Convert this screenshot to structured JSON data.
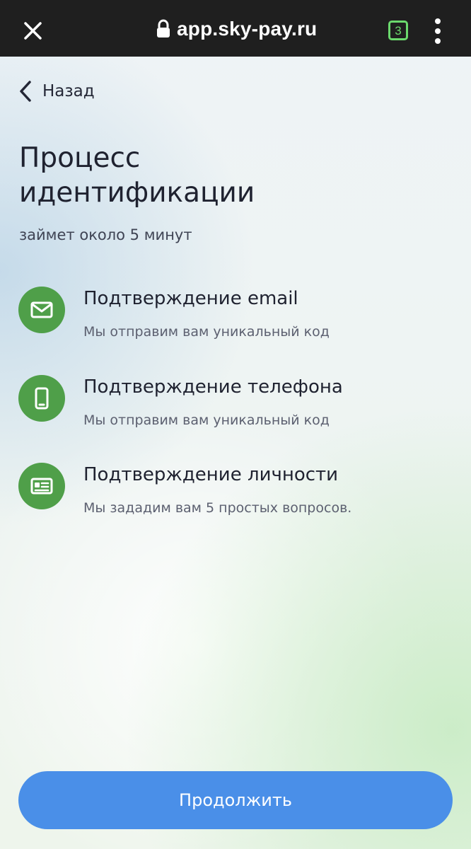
{
  "browser": {
    "close_icon": "close-icon",
    "lock_icon": "lock-icon",
    "url": "app.sky-pay.ru",
    "tab_count": "3",
    "tab_count_color": "#6bd96d",
    "menu_icon": "more-vert-icon",
    "topbar_color": "#1f1f1f"
  },
  "page": {
    "back": {
      "icon": "chevron-left-icon",
      "label": "Назад"
    },
    "title": "Процесс идентификации",
    "subtitle": "займет около 5 минут",
    "steps": [
      {
        "icon": "mail-icon",
        "title": "Подтверждение email",
        "description": "Мы отправим вам уникальный код"
      },
      {
        "icon": "phone-icon",
        "title": "Подтверждение телефона",
        "description": "Мы отправим вам уникальный код"
      },
      {
        "icon": "id-card-icon",
        "title": "Подтверждение личности",
        "description": "Мы зададим вам 5 простых вопросов."
      }
    ],
    "continue_label": "Продолжить",
    "accent_color": "#4a8fe8",
    "step_icon_color": "#4f9f49"
  }
}
